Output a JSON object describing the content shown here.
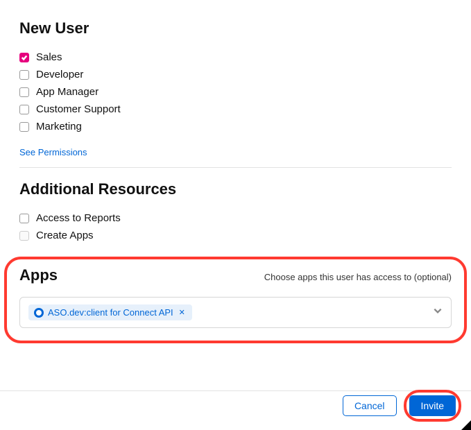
{
  "new_user": {
    "heading": "New User",
    "roles": [
      {
        "label": "Sales",
        "checked": true
      },
      {
        "label": "Developer",
        "checked": false
      },
      {
        "label": "App Manager",
        "checked": false
      },
      {
        "label": "Customer Support",
        "checked": false
      },
      {
        "label": "Marketing",
        "checked": false
      }
    ],
    "see_permissions": "See Permissions"
  },
  "additional_resources": {
    "heading": "Additional Resources",
    "items": [
      {
        "label": "Access to Reports",
        "checked": false,
        "disabled": false
      },
      {
        "label": "Create Apps",
        "checked": false,
        "disabled": true
      }
    ]
  },
  "apps": {
    "heading": "Apps",
    "hint": "Choose apps this user has access to (optional)",
    "selected": [
      {
        "label": "ASO.dev:client for Connect API"
      }
    ]
  },
  "footer": {
    "cancel": "Cancel",
    "invite": "Invite"
  }
}
